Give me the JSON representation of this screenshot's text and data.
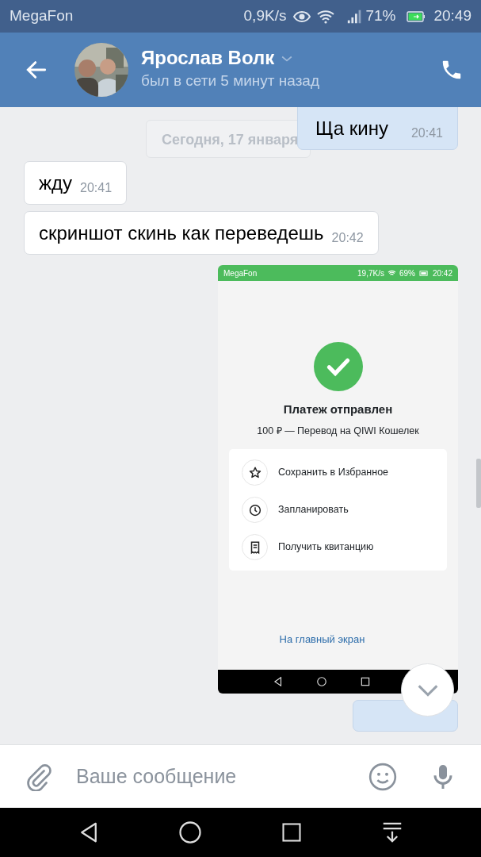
{
  "status_bar": {
    "carrier": "MegaFon",
    "speed": "0,9K/s",
    "battery": "71%",
    "time": "20:49"
  },
  "header": {
    "name": "Ярослав Волк",
    "status": "был в сети 5 минут назад"
  },
  "date_divider": "Сегодня, 17 января",
  "messages": [
    {
      "kind": "text",
      "outgoing": true,
      "text": "Ща кину",
      "time": "20:41"
    },
    {
      "kind": "text",
      "outgoing": false,
      "text": "жду",
      "time": "20:41"
    },
    {
      "kind": "text",
      "outgoing": false,
      "text": "скриншот скинь как переведешь",
      "time": "20:42"
    },
    {
      "kind": "screenshot",
      "outgoing": true,
      "screenshot": {
        "status_bar": {
          "carrier": "MegaFon",
          "speed": "19,7K/s",
          "battery": "69%",
          "time": "20:42"
        },
        "title": "Платеж отправлен",
        "subtitle": "100 ₽ — Перевод на QIWI Кошелек",
        "actions": [
          {
            "kind": "star",
            "label": "Сохранить в Избранное"
          },
          {
            "kind": "clock",
            "label": "Запланировать"
          },
          {
            "kind": "receipt",
            "label": "Получить квитанцию"
          }
        ],
        "home_link": "На главный экран"
      }
    },
    {
      "kind": "partial",
      "outgoing": true
    }
  ],
  "composer": {
    "placeholder": "Ваше сообщение"
  }
}
